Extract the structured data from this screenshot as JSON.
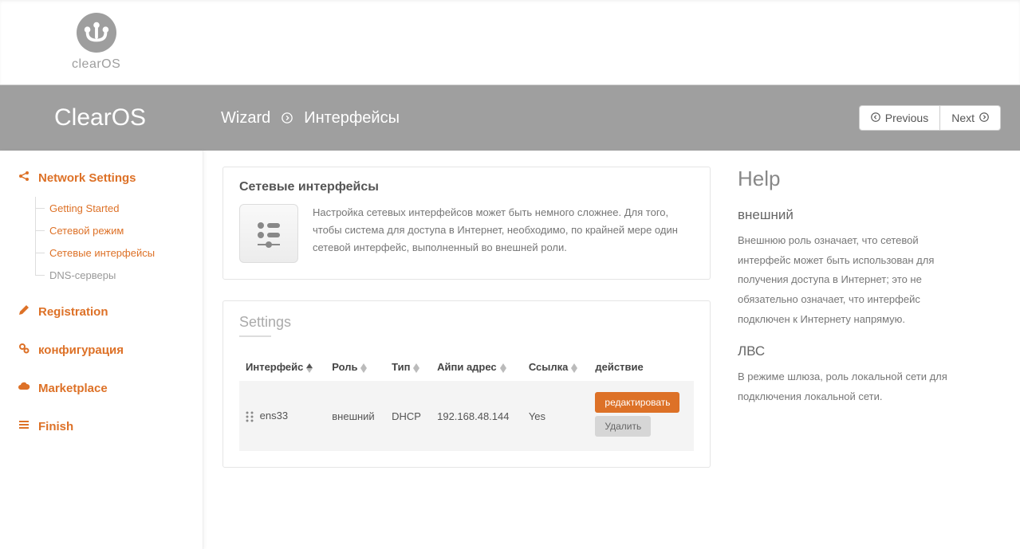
{
  "brand": "clearOS",
  "app_title": "ClearOS",
  "breadcrumb": {
    "root": "Wizard",
    "page": "Интерфейсы"
  },
  "nav_buttons": {
    "prev": "Previous",
    "next": "Next"
  },
  "sidebar": {
    "items": [
      {
        "label": "Network Settings",
        "icon": "share"
      },
      {
        "label": "Registration",
        "icon": "pencil"
      },
      {
        "label": "конфигурация",
        "icon": "cogs"
      },
      {
        "label": "Marketplace",
        "icon": "cloud"
      },
      {
        "label": "Finish",
        "icon": "list"
      }
    ],
    "sub_items": [
      {
        "label": "Getting Started"
      },
      {
        "label": "Сетевой режим"
      },
      {
        "label": "Сетевые интерфейсы"
      },
      {
        "label": "DNS-серверы"
      }
    ]
  },
  "panel": {
    "title": "Сетевые интерфейсы",
    "desc": "Настройка сетевых интерфейсов может быть немного сложнее. Для того, чтобы система для доступа в Интернет, необходимо, по крайней мере один сетевой интерфейс, выполненный во внешней роли."
  },
  "settings": {
    "heading": "Settings",
    "columns": {
      "iface": "Интерфейс",
      "role": "Роль",
      "type": "Тип",
      "ip": "Айпи адрес",
      "link": "Ссылка",
      "action": "действие"
    },
    "rows": [
      {
        "iface": "ens33",
        "role": "внешний",
        "type": "DHCP",
        "ip": "192.168.48.144",
        "link": "Yes"
      }
    ],
    "buttons": {
      "edit": "редактировать",
      "del": "Удалить"
    }
  },
  "help": {
    "title": "Help",
    "sections": [
      {
        "heading": "внешний",
        "body": "Внешнюю роль означает, что сетевой интерфейс может быть использован для получения доступа в Интернет; это не обязательно означает, что интерфейс подключен к Интернету напрямую."
      },
      {
        "heading": "ЛВС",
        "body": "В режиме шлюза, роль локальной сети для подключения локальной сети."
      }
    ]
  }
}
